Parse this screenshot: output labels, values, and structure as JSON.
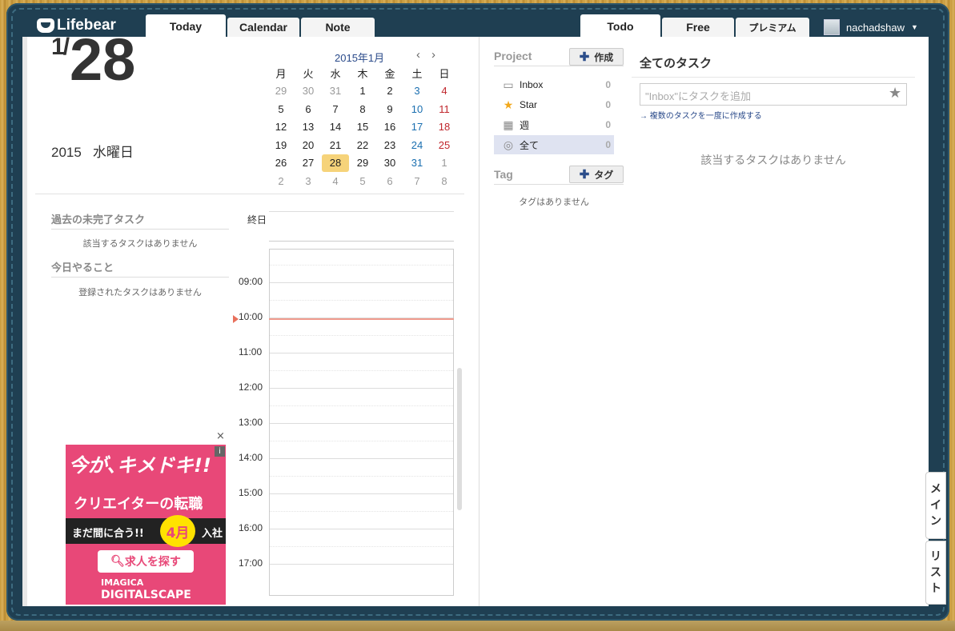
{
  "app": {
    "logo": "Lifebear"
  },
  "tabs_left": [
    {
      "label": "Today",
      "active": true
    },
    {
      "label": "Calendar",
      "active": false
    },
    {
      "label": "Note",
      "active": false
    }
  ],
  "tabs_right": [
    {
      "label": "Todo",
      "active": true
    },
    {
      "label": "Free",
      "active": false
    },
    {
      "label": "プレミアム",
      "active": false
    }
  ],
  "user": {
    "name": "nachadshaw"
  },
  "today": {
    "month": "1",
    "day": "28",
    "year": "2015",
    "weekday": "水曜日"
  },
  "calendar": {
    "title": "2015年1月",
    "prev": "‹",
    "next": "›",
    "weekdays": [
      "月",
      "火",
      "水",
      "木",
      "金",
      "土",
      "日"
    ],
    "weeks": [
      [
        "29",
        "30",
        "31",
        "1",
        "2",
        "3",
        "4"
      ],
      [
        "5",
        "6",
        "7",
        "8",
        "9",
        "10",
        "11"
      ],
      [
        "12",
        "13",
        "14",
        "15",
        "16",
        "17",
        "18"
      ],
      [
        "19",
        "20",
        "21",
        "22",
        "23",
        "24",
        "25"
      ],
      [
        "26",
        "27",
        "28",
        "29",
        "30",
        "31",
        "1"
      ],
      [
        "2",
        "3",
        "4",
        "5",
        "6",
        "7",
        "8"
      ]
    ],
    "selected": "28"
  },
  "sections": {
    "past_title": "過去の未完了タスク",
    "past_empty": "該当するタスクはありません",
    "today_title": "今日やること",
    "today_empty": "登録されたタスクはありません"
  },
  "schedule": {
    "allday": "終日",
    "hours": [
      "09:00",
      "10:00",
      "11:00",
      "12:00",
      "13:00",
      "14:00",
      "15:00",
      "16:00",
      "17:00"
    ]
  },
  "ad": {
    "line1": "今が､キメドキ!!",
    "line2": "クリエイターの転職",
    "line3": "まだ間に合う!!",
    "badge": "4月",
    "line4": "入社",
    "button": "求人を探す",
    "brand1": "IMAGICA",
    "brand2": "DIGITALSCAPE",
    "close": "×",
    "info": "i"
  },
  "project": {
    "title": "Project",
    "create": "作成",
    "items": [
      {
        "label": "Inbox",
        "count": "0",
        "icon": "inbox-icon"
      },
      {
        "label": "Star",
        "count": "0",
        "icon": "star-icon"
      },
      {
        "label": "週",
        "count": "0",
        "icon": "calendar-week-icon"
      },
      {
        "label": "全て",
        "count": "0",
        "icon": "all-icon",
        "selected": true
      }
    ]
  },
  "tag": {
    "title": "Tag",
    "create": "タグ",
    "empty": "タグはありません"
  },
  "tasks": {
    "title": "全てのタスク",
    "placeholder": "\"Inbox\"にタスクを追加",
    "bulk_link": "→ 複数のタスクを一度に作成する",
    "empty": "該当するタスクはありません"
  },
  "side_tabs": {
    "main": "メイン",
    "list": "リスト"
  }
}
